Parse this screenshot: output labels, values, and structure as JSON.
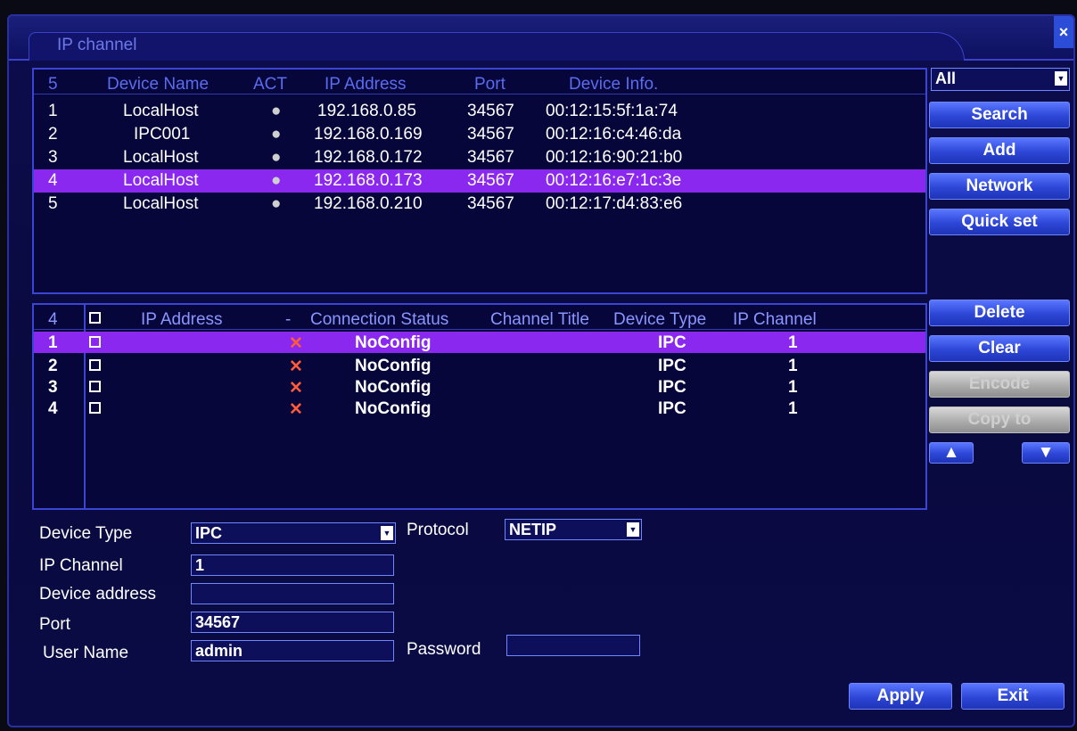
{
  "window": {
    "title": "IP channel",
    "close_glyph": "×"
  },
  "filter": {
    "selected": "All"
  },
  "side_buttons_top": [
    {
      "label": "Search"
    },
    {
      "label": "Add"
    },
    {
      "label": "Network"
    },
    {
      "label": "Quick set"
    }
  ],
  "side_buttons_bottom": [
    {
      "label": "Delete"
    },
    {
      "label": "Clear"
    },
    {
      "label": "Encode"
    },
    {
      "label": "Copy to"
    }
  ],
  "device_table": {
    "count": "5",
    "headers": [
      "Device Name",
      "ACT",
      "IP Address",
      "Port",
      "Device Info."
    ],
    "rows": [
      {
        "num": "1",
        "name": "LocalHost",
        "act": "●",
        "ip": "192.168.0.85",
        "port": "34567",
        "info": "00:12:15:5f:1a:74"
      },
      {
        "num": "2",
        "name": "IPC001",
        "act": "●",
        "ip": "192.168.0.169",
        "port": "34567",
        "info": "00:12:16:c4:46:da"
      },
      {
        "num": "3",
        "name": "LocalHost",
        "act": "●",
        "ip": "192.168.0.172",
        "port": "34567",
        "info": "00:12:16:90:21:b0"
      },
      {
        "num": "4",
        "name": "LocalHost",
        "act": "●",
        "ip": "192.168.0.173",
        "port": "34567",
        "info": "00:12:16:e7:1c:3e"
      },
      {
        "num": "5",
        "name": "LocalHost",
        "act": "●",
        "ip": "192.168.0.210",
        "port": "34567",
        "info": "00:12:17:d4:83:e6"
      }
    ]
  },
  "channel_table": {
    "count": "4",
    "headers": [
      "IP Address",
      "-",
      "Connection Status",
      "Channel Title",
      "Device Type",
      "IP Channel"
    ],
    "rows": [
      {
        "num": "1",
        "status_icon": "✕",
        "status": "NoConfig",
        "type": "IPC",
        "channel": "1"
      },
      {
        "num": "2",
        "status_icon": "✕",
        "status": "NoConfig",
        "type": "IPC",
        "channel": "1"
      },
      {
        "num": "3",
        "status_icon": "✕",
        "status": "NoConfig",
        "type": "IPC",
        "channel": "1"
      },
      {
        "num": "4",
        "status_icon": "✕",
        "status": "NoConfig",
        "type": "IPC",
        "channel": "1"
      }
    ]
  },
  "form": {
    "device_type_label": "Device Type",
    "device_type_value": "IPC",
    "protocol_label": "Protocol",
    "protocol_value": "NETIP",
    "ip_channel_label": "IP Channel",
    "ip_channel_value": "1",
    "device_address_label": "Device address",
    "device_address_value": "",
    "port_label": "Port",
    "port_value": "34567",
    "user_label": "User Name",
    "user_value": "admin",
    "password_label": "Password",
    "password_value": ""
  },
  "footer": {
    "apply": "Apply",
    "exit": "Exit"
  },
  "colors": {
    "selection": "#8a28f0",
    "header_text": "#5a6cf0",
    "status_x": "#ff5a3a"
  }
}
